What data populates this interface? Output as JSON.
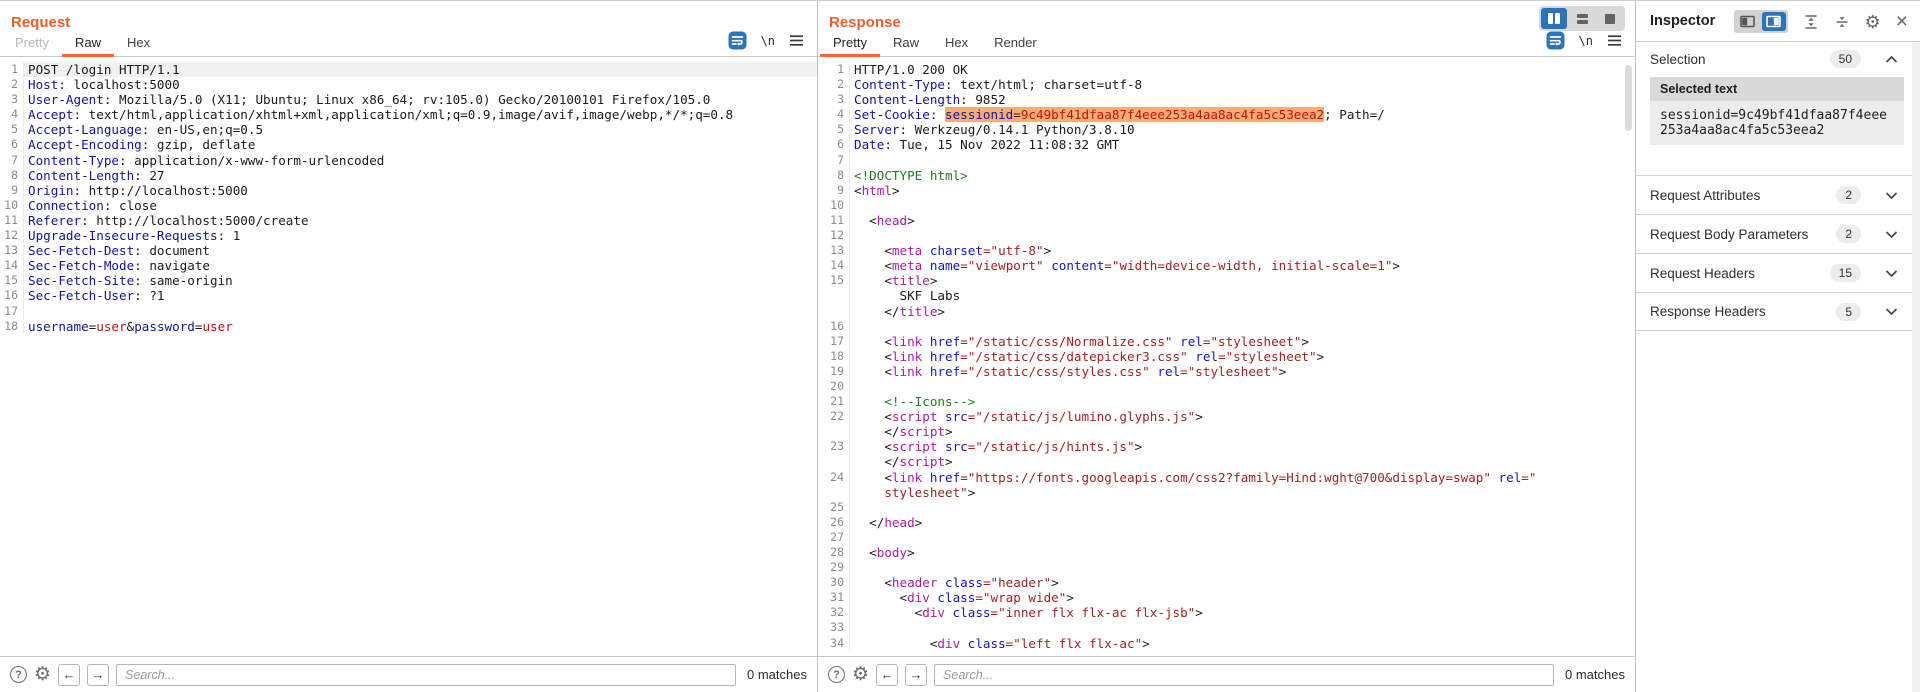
{
  "icons": {
    "newline_label": "\\n"
  },
  "request": {
    "title": "Request",
    "tabs": [
      {
        "label": "Pretty",
        "state": "disabled"
      },
      {
        "label": "Raw",
        "state": "selected"
      },
      {
        "label": "Hex",
        "state": ""
      }
    ],
    "search_placeholder": "Search...",
    "matches": "0 matches",
    "lines": [
      {
        "n": "1",
        "caret": true,
        "rows": [
          [
            [
              "pl",
              "POST /login HTTP/1.1"
            ]
          ]
        ]
      },
      {
        "n": "2",
        "rows": [
          [
            [
              "hn",
              "Host"
            ],
            [
              "pl",
              ": localhost:5000"
            ]
          ]
        ]
      },
      {
        "n": "3",
        "rows": [
          [
            [
              "hn",
              "User-Agent"
            ],
            [
              "pl",
              ": Mozilla/5.0 (X11; Ubuntu; Linux x86_64; rv:105.0) Gecko/20100101 Firefox/105.0"
            ]
          ]
        ]
      },
      {
        "n": "4",
        "rows": [
          [
            [
              "hn",
              "Accept"
            ],
            [
              "pl",
              ": text/html,application/xhtml+xml,application/xml;q=0.9,image/avif,image/webp,*/*;q=0.8"
            ]
          ]
        ]
      },
      {
        "n": "5",
        "rows": [
          [
            [
              "hn",
              "Accept-Language"
            ],
            [
              "pl",
              ": en-US,en;q=0.5"
            ]
          ]
        ]
      },
      {
        "n": "6",
        "rows": [
          [
            [
              "hn",
              "Accept-Encoding"
            ],
            [
              "pl",
              ": gzip, deflate"
            ]
          ]
        ]
      },
      {
        "n": "7",
        "rows": [
          [
            [
              "hn",
              "Content-Type"
            ],
            [
              "pl",
              ": application/x-www-form-urlencoded"
            ]
          ]
        ]
      },
      {
        "n": "8",
        "rows": [
          [
            [
              "hn",
              "Content-Length"
            ],
            [
              "pl",
              ": 27"
            ]
          ]
        ]
      },
      {
        "n": "9",
        "rows": [
          [
            [
              "hn",
              "Origin"
            ],
            [
              "pl",
              ": http://localhost:5000"
            ]
          ]
        ]
      },
      {
        "n": "10",
        "rows": [
          [
            [
              "hn",
              "Connection"
            ],
            [
              "pl",
              ": close"
            ]
          ]
        ]
      },
      {
        "n": "11",
        "rows": [
          [
            [
              "hn",
              "Referer"
            ],
            [
              "pl",
              ": http://localhost:5000/create"
            ]
          ]
        ]
      },
      {
        "n": "12",
        "rows": [
          [
            [
              "hn",
              "Upgrade-Insecure-Requests"
            ],
            [
              "pl",
              ": 1"
            ]
          ]
        ]
      },
      {
        "n": "13",
        "rows": [
          [
            [
              "hn",
              "Sec-Fetch-Dest"
            ],
            [
              "pl",
              ": document"
            ]
          ]
        ]
      },
      {
        "n": "14",
        "rows": [
          [
            [
              "hn",
              "Sec-Fetch-Mode"
            ],
            [
              "pl",
              ": navigate"
            ]
          ]
        ]
      },
      {
        "n": "15",
        "rows": [
          [
            [
              "hn",
              "Sec-Fetch-Site"
            ],
            [
              "pl",
              ": same-origin"
            ]
          ]
        ]
      },
      {
        "n": "16",
        "rows": [
          [
            [
              "hn",
              "Sec-Fetch-User"
            ],
            [
              "pl",
              ": ?1"
            ]
          ]
        ]
      },
      {
        "n": "17",
        "rows": [
          []
        ]
      },
      {
        "n": "18",
        "rows": [
          [
            [
              "pn",
              "username"
            ],
            [
              "pl",
              "="
            ],
            [
              "pv",
              "user"
            ],
            [
              "pl",
              "&"
            ],
            [
              "pn",
              "password"
            ],
            [
              "pl",
              "="
            ],
            [
              "pv",
              "user"
            ]
          ]
        ]
      }
    ]
  },
  "response": {
    "title": "Response",
    "tabs": [
      {
        "label": "Pretty",
        "state": "selected"
      },
      {
        "label": "Raw",
        "state": ""
      },
      {
        "label": "Hex",
        "state": ""
      },
      {
        "label": "Render",
        "state": ""
      }
    ],
    "layout_toggle": {
      "options": [
        "columns",
        "rows",
        "single"
      ],
      "selected": "columns"
    },
    "search_placeholder": "Search...",
    "matches": "0 matches",
    "lines": [
      {
        "n": "1",
        "rows": [
          [
            [
              "pl",
              "HTTP/1.0 200 OK"
            ]
          ]
        ]
      },
      {
        "n": "2",
        "rows": [
          [
            [
              "hn",
              "Content-Type"
            ],
            [
              "pl",
              ": text/html; charset=utf-8"
            ]
          ]
        ]
      },
      {
        "n": "3",
        "rows": [
          [
            [
              "hn",
              "Content-Length"
            ],
            [
              "pl",
              ": 9852"
            ]
          ]
        ]
      },
      {
        "n": "4",
        "rows": [
          [
            [
              "hn",
              "Set-Cookie"
            ],
            [
              "pl",
              ": "
            ],
            [
              "pn hl",
              "sessionid"
            ],
            [
              "pl hl",
              "="
            ],
            [
              "pv hl",
              "9c49bf41dfaa87f4eee253a4aa8ac4fa5c53eea2"
            ],
            [
              "pl",
              "; Path=/"
            ]
          ]
        ]
      },
      {
        "n": "5",
        "rows": [
          [
            [
              "hn",
              "Server"
            ],
            [
              "pl",
              ": Werkzeug/0.14.1 Python/3.8.10"
            ]
          ]
        ]
      },
      {
        "n": "6",
        "rows": [
          [
            [
              "hn",
              "Date"
            ],
            [
              "pl",
              ": Tue, 15 Nov 2022 11:08:32 GMT"
            ]
          ]
        ]
      },
      {
        "n": "7",
        "rows": [
          []
        ]
      },
      {
        "n": "8",
        "rows": [
          [
            [
              "doc",
              "<!DOCTYPE html>"
            ]
          ]
        ]
      },
      {
        "n": "9",
        "rows": [
          [
            [
              "pl",
              "<"
            ],
            [
              "tag",
              "html"
            ],
            [
              "pl",
              ">"
            ]
          ]
        ]
      },
      {
        "n": "10",
        "rows": [
          []
        ]
      },
      {
        "n": "11",
        "rows": [
          [
            [
              "pl",
              "  <"
            ],
            [
              "tag",
              "head"
            ],
            [
              "pl",
              ">"
            ]
          ]
        ]
      },
      {
        "n": "12",
        "rows": [
          []
        ]
      },
      {
        "n": "13",
        "rows": [
          [
            [
              "pl",
              "    <"
            ],
            [
              "tag",
              "meta"
            ],
            [
              "pl",
              " "
            ],
            [
              "attr",
              "charset"
            ],
            [
              "avl",
              "=\"utf-8\""
            ],
            [
              "pl",
              ">"
            ]
          ]
        ]
      },
      {
        "n": "14",
        "rows": [
          [
            [
              "pl",
              "    <"
            ],
            [
              "tag",
              "meta"
            ],
            [
              "pl",
              " "
            ],
            [
              "attr",
              "name"
            ],
            [
              "avl",
              "=\"viewport\""
            ],
            [
              "pl",
              " "
            ],
            [
              "attr",
              "content"
            ],
            [
              "avl",
              "=\"width=device-width, initial-scale=1\""
            ],
            [
              "pl",
              ">"
            ]
          ]
        ]
      },
      {
        "n": "15",
        "rows": [
          [
            [
              "pl",
              "    <"
            ],
            [
              "tag",
              "title"
            ],
            [
              "pl",
              ">"
            ]
          ],
          [
            [
              "pl",
              "      SKF Labs"
            ]
          ],
          [
            [
              "pl",
              "    </"
            ],
            [
              "tag",
              "title"
            ],
            [
              "pl",
              ">"
            ]
          ]
        ]
      },
      {
        "n": "16",
        "rows": [
          []
        ]
      },
      {
        "n": "17",
        "rows": [
          [
            [
              "pl",
              "    <"
            ],
            [
              "tag",
              "link"
            ],
            [
              "pl",
              " "
            ],
            [
              "attr",
              "href"
            ],
            [
              "avl",
              "=\"/static/css/Normalize.css\""
            ],
            [
              "pl",
              " "
            ],
            [
              "attr",
              "rel"
            ],
            [
              "avl",
              "=\"stylesheet\""
            ],
            [
              "pl",
              ">"
            ]
          ]
        ]
      },
      {
        "n": "18",
        "rows": [
          [
            [
              "pl",
              "    <"
            ],
            [
              "tag",
              "link"
            ],
            [
              "pl",
              " "
            ],
            [
              "attr",
              "href"
            ],
            [
              "avl",
              "=\"/static/css/datepicker3.css\""
            ],
            [
              "pl",
              " "
            ],
            [
              "attr",
              "rel"
            ],
            [
              "avl",
              "=\"stylesheet\""
            ],
            [
              "pl",
              ">"
            ]
          ]
        ]
      },
      {
        "n": "19",
        "rows": [
          [
            [
              "pl",
              "    <"
            ],
            [
              "tag",
              "link"
            ],
            [
              "pl",
              " "
            ],
            [
              "attr",
              "href"
            ],
            [
              "avl",
              "=\"/static/css/styles.css\""
            ],
            [
              "pl",
              " "
            ],
            [
              "attr",
              "rel"
            ],
            [
              "avl",
              "=\"stylesheet\""
            ],
            [
              "pl",
              ">"
            ]
          ]
        ]
      },
      {
        "n": "20",
        "rows": [
          []
        ]
      },
      {
        "n": "21",
        "rows": [
          [
            [
              "pl",
              "    "
            ],
            [
              "cm",
              "<!--Icons-->"
            ]
          ]
        ]
      },
      {
        "n": "22",
        "rows": [
          [
            [
              "pl",
              "    <"
            ],
            [
              "tag",
              "script"
            ],
            [
              "pl",
              " "
            ],
            [
              "attr",
              "src"
            ],
            [
              "avl",
              "=\"/static/js/lumino.glyphs.js\""
            ],
            [
              "pl",
              ">"
            ]
          ],
          [
            [
              "pl",
              "    </"
            ],
            [
              "tag",
              "script"
            ],
            [
              "pl",
              ">"
            ]
          ]
        ]
      },
      {
        "n": "23",
        "rows": [
          [
            [
              "pl",
              "    <"
            ],
            [
              "tag",
              "script"
            ],
            [
              "pl",
              " "
            ],
            [
              "attr",
              "src"
            ],
            [
              "avl",
              "=\"/static/js/hints.js\""
            ],
            [
              "pl",
              ">"
            ]
          ],
          [
            [
              "pl",
              "    </"
            ],
            [
              "tag",
              "script"
            ],
            [
              "pl",
              ">"
            ]
          ]
        ]
      },
      {
        "n": "24",
        "rows": [
          [
            [
              "pl",
              "    <"
            ],
            [
              "tag",
              "link"
            ],
            [
              "pl",
              " "
            ],
            [
              "attr",
              "href"
            ],
            [
              "avl",
              "=\"https://fonts.googleapis.com/css2?family=Hind:wght@700&display=swap\""
            ],
            [
              "pl",
              " "
            ],
            [
              "attr",
              "rel"
            ],
            [
              "avl",
              "=\""
            ]
          ],
          [
            [
              "pl",
              "    "
            ],
            [
              "avl",
              "stylesheet\""
            ],
            [
              "pl",
              ">"
            ]
          ]
        ]
      },
      {
        "n": "25",
        "rows": [
          []
        ]
      },
      {
        "n": "26",
        "rows": [
          [
            [
              "pl",
              "  </"
            ],
            [
              "tag",
              "head"
            ],
            [
              "pl",
              ">"
            ]
          ]
        ]
      },
      {
        "n": "27",
        "rows": [
          []
        ]
      },
      {
        "n": "28",
        "rows": [
          [
            [
              "pl",
              "  <"
            ],
            [
              "tag",
              "body"
            ],
            [
              "pl",
              ">"
            ]
          ]
        ]
      },
      {
        "n": "29",
        "rows": [
          []
        ]
      },
      {
        "n": "30",
        "rows": [
          [
            [
              "pl",
              "    <"
            ],
            [
              "tag",
              "header"
            ],
            [
              "pl",
              " "
            ],
            [
              "attr",
              "class"
            ],
            [
              "avl",
              "=\"header\""
            ],
            [
              "pl",
              ">"
            ]
          ]
        ]
      },
      {
        "n": "31",
        "rows": [
          [
            [
              "pl",
              "      <"
            ],
            [
              "tag",
              "div"
            ],
            [
              "pl",
              " "
            ],
            [
              "attr",
              "class"
            ],
            [
              "avl",
              "=\"wrap wide\""
            ],
            [
              "pl",
              ">"
            ]
          ]
        ]
      },
      {
        "n": "32",
        "rows": [
          [
            [
              "pl",
              "        <"
            ],
            [
              "tag",
              "div"
            ],
            [
              "pl",
              " "
            ],
            [
              "attr",
              "class"
            ],
            [
              "avl",
              "=\"inner flx flx-ac flx-jsb\""
            ],
            [
              "pl",
              ">"
            ]
          ]
        ]
      },
      {
        "n": "33",
        "rows": [
          []
        ]
      },
      {
        "n": "34",
        "rows": [
          [
            [
              "pl",
              "          <"
            ],
            [
              "tag",
              "div"
            ],
            [
              "pl",
              " "
            ],
            [
              "attr",
              "class"
            ],
            [
              "avl",
              "=\"left flx flx-ac\""
            ],
            [
              "pl",
              ">"
            ]
          ]
        ]
      }
    ]
  },
  "inspector": {
    "title": "Inspector",
    "dock_toggle": {
      "options": [
        "dock-left",
        "dock-right"
      ],
      "selected": "dock-right"
    },
    "selection": {
      "label": "Selection",
      "count": "50",
      "card_title": "Selected text",
      "card_value": "sessionid=9c49bf41dfaa87f4eee253a4aa8ac4fa5c53eea2"
    },
    "sections": [
      {
        "label": "Request Attributes",
        "count": "2"
      },
      {
        "label": "Request Body Parameters",
        "count": "2"
      },
      {
        "label": "Request Headers",
        "count": "15"
      },
      {
        "label": "Response Headers",
        "count": "5"
      }
    ]
  },
  "colors": {
    "accent_orange": "#e8612c",
    "tab_underline": "#ff6633",
    "selection_highlight": "#f9ad72",
    "toggle_blue": "#2e72b8",
    "header_name_blue": "#14149a",
    "value_red": "#bf1313",
    "tag_magenta": "#a81ca8",
    "comment_green": "#1e7c1e"
  }
}
